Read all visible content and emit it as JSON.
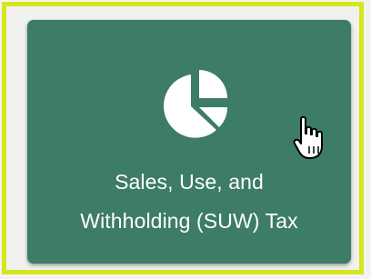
{
  "tile": {
    "label_line_1": "Sales, Use, and",
    "label_line_2": "Withholding (SUW) Tax",
    "icon": "pie-chart-icon",
    "color": "#3d7c66"
  },
  "highlight": {
    "color": "#d6e61e"
  },
  "cursor": {
    "icon": "hand-pointer-icon"
  }
}
